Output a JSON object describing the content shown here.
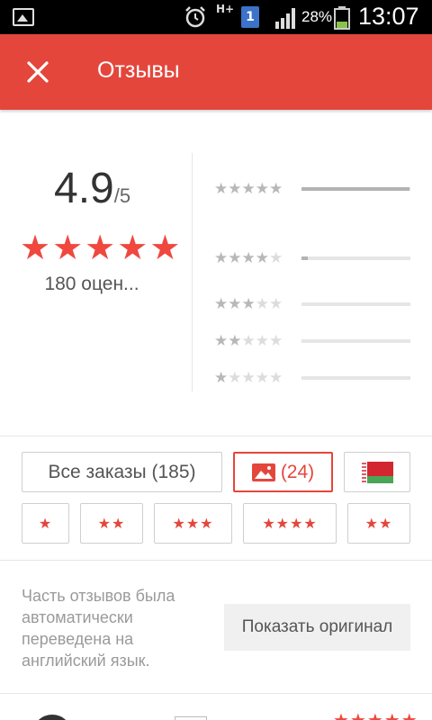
{
  "status_bar": {
    "network": "H+",
    "sim": "1",
    "battery_percent": "28%",
    "time": "13:07",
    "icons": [
      "gallery-icon",
      "alarm-icon",
      "signal-icon",
      "battery-icon"
    ]
  },
  "app_bar": {
    "title": "Отзывы",
    "close_icon": "close-icon",
    "color": "#e4463c"
  },
  "summary": {
    "score": "4.9",
    "score_max": "/5",
    "stars_filled": 5,
    "rating_count": "180 оцен...",
    "distribution": [
      {
        "stars": 5,
        "fraction": 0.99
      },
      {
        "stars": 4,
        "fraction": 0.06
      },
      {
        "stars": 3,
        "fraction": 0
      },
      {
        "stars": 2,
        "fraction": 0
      },
      {
        "stars": 1,
        "fraction": 0
      }
    ]
  },
  "filters": {
    "all_orders": "Все заказы (185)",
    "photos": "(24)",
    "photo_icon": "image-icon",
    "flag": "belarus-flag-icon",
    "star_filters": [
      "★",
      "★★",
      "★★★",
      "★★★★",
      "★★"
    ]
  },
  "notice": {
    "text": "Часть отзывов была автоматически переведена на английский язык.",
    "show_original": "Показать оригинал"
  },
  "review": {
    "stars": "★★★★★"
  },
  "colors": {
    "accent": "#e4463c",
    "star": "#f0473e"
  }
}
